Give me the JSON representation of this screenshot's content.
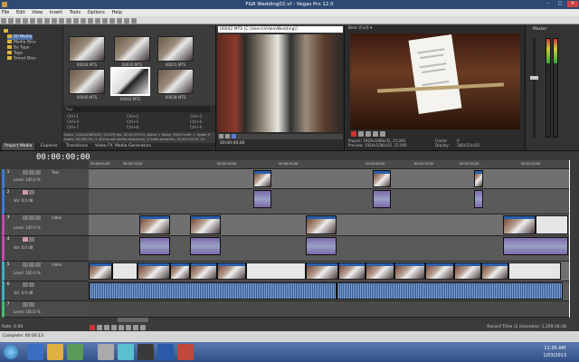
{
  "window": {
    "title": "F&R Wedding02.vf - Vegas Pro 12.0"
  },
  "menu": [
    "File",
    "Edit",
    "View",
    "Insert",
    "Tools",
    "Options",
    "Help"
  ],
  "media_tree": {
    "items": [
      "All Media",
      "Media Bins",
      "By Type",
      "Tags",
      "Smart Bins"
    ]
  },
  "media_browser": {
    "thumbs": [
      "00028.MTS",
      "00030.MTS",
      "00031.MTS",
      "00040.MTS",
      "00042.MTS",
      "00038.MTS"
    ],
    "props": [
      "Ctrl+1",
      "Ctrl+2",
      "Ctrl+3",
      "Ctrl+4",
      "Ctrl+5",
      "Ctrl+6",
      "Ctrl+7",
      "Ctrl+8",
      "Ctrl+9"
    ],
    "tag_placeholder": "Tags",
    "info": [
      "Video: 1440x1080x32, 29.970 fps, 00:00:29:04, Alpha = None, Field Order = Upper fi",
      "Audio: 48,000 Hz, 2 (Surround stereo downmix) (2 total streams), 00:00:29:04, Co"
    ]
  },
  "left_tabs": [
    "Project Media",
    "Explorer",
    "Transitions",
    "Video FX",
    "Media Generators"
  ],
  "trimmer": {
    "file": "00042.MTS   [C:\\Users\\Video\\Wedding\\]",
    "time": "00:00:00;00"
  },
  "preview": {
    "mode": "Best (Full)",
    "project": "Project:  1920x1080x32, 25.000",
    "preview_res": "Preview:  1920x1080x32, 25.000",
    "frame_label": "Frame:",
    "frame_value": "0",
    "display_label": "Display:",
    "display_value": "380x214x32"
  },
  "master": {
    "label": "Master"
  },
  "timeline": {
    "timecode": "00:00:00;00",
    "ruler": [
      "00:00:00;00",
      "00:00:15;00",
      "00:00:30;00",
      "00:00:45;00",
      "00:01:00;00",
      "00:01:15;00",
      "00:01:30;00",
      "00:01:45;00"
    ],
    "tracks": [
      {
        "num": "1",
        "name": "Text",
        "level": "Level: 100.0 %"
      },
      {
        "num": "2",
        "name": "",
        "level": "Vol: 0.0 dB"
      },
      {
        "num": "3",
        "name": "Video",
        "level": "Level: 100.0 %"
      },
      {
        "num": "4",
        "name": "",
        "level": "Vol: 0.0 dB"
      },
      {
        "num": "5",
        "name": "Video",
        "level": "Level: 100.0 %"
      },
      {
        "num": "6",
        "name": "",
        "level": "Vol: 0.0 dB"
      },
      {
        "num": "7",
        "name": "",
        "level": "Level: 100.0 %"
      }
    ],
    "rate": "Rate: 0.00",
    "record_time": "Record Time (2 channels): 1,359:34:48"
  },
  "status": {
    "left": "Complete: 00:00:13"
  },
  "taskbar": {
    "time": "11:30 AM",
    "date": "1/03/2013"
  }
}
